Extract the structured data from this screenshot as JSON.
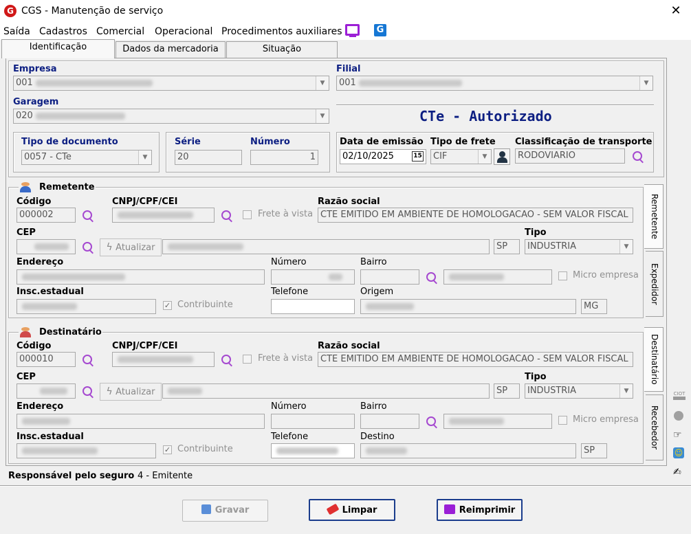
{
  "window": {
    "title": "CGS - Manutenção de serviço",
    "close": "✕",
    "app_icon": "G"
  },
  "menu": [
    "Saída",
    "Cadastros",
    "Comercial",
    "Operacional",
    "Procedimentos auxiliares"
  ],
  "menu_icons": [
    "monitor-icon",
    "cgs-g-icon"
  ],
  "tabs": [
    "Identificação",
    "Dados da mercadoria",
    "Situação"
  ],
  "empresa": {
    "label": "Empresa",
    "value": "001"
  },
  "filial": {
    "label": "Filial",
    "value": "001"
  },
  "garagem": {
    "label": "Garagem",
    "value": "020"
  },
  "status": "CTe - Autorizado",
  "tipo_doc": {
    "label": "Tipo de documento",
    "value": "0057 - CTe"
  },
  "serie": {
    "label": "Série",
    "value": "20"
  },
  "numero": {
    "label": "Número",
    "value": "1"
  },
  "data_emissao": {
    "label": "Data de emissão",
    "value": "02/10/2025",
    "cal": "15"
  },
  "tipo_frete": {
    "label": "Tipo de frete",
    "value": "CIF"
  },
  "classificacao": {
    "label": "Classificação de transporte",
    "value": "RODOVIARIO"
  },
  "remetente": {
    "title": "Remetente",
    "codigo_label": "Código",
    "codigo": "000002",
    "cnpj_label": "CNPJ/CPF/CEI",
    "frete_vista": "Frete à vista",
    "razao_label": "Razão social",
    "razao": "CTE EMITIDO EM AMBIENTE DE HOMOLOGACAO - SEM VALOR FISCAL",
    "cep_label": "CEP",
    "atualizar": "Atualizar",
    "uf": "SP",
    "tipo_label": "Tipo",
    "tipo": "INDUSTRIA",
    "endereco_label": "Endereço",
    "numero_label": "Número",
    "bairro_label": "Bairro",
    "micro": "Micro empresa",
    "insc_label": "Insc.estadual",
    "contribuinte": "Contribuinte",
    "telefone_label": "Telefone",
    "origem_label": "Origem",
    "origem_uf": "MG"
  },
  "destinatario": {
    "title": "Destinatário",
    "codigo_label": "Código",
    "codigo": "000010",
    "cnpj_label": "CNPJ/CPF/CEI",
    "frete_vista": "Frete à vista",
    "razao_label": "Razão social",
    "razao": "CTE EMITIDO EM AMBIENTE DE HOMOLOGACAO - SEM VALOR FISCAL",
    "cep_label": "CEP",
    "atualizar": "Atualizar",
    "uf": "SP",
    "tipo_label": "Tipo",
    "tipo": "INDUSTRIA",
    "endereco_label": "Endereço",
    "numero_label": "Número",
    "bairro_label": "Bairro",
    "micro": "Micro empresa",
    "insc_label": "Insc.estadual",
    "contribuinte": "Contribuinte",
    "telefone_label": "Telefone",
    "destino_label": "Destino",
    "destino_uf": "SP"
  },
  "vtabs": {
    "top": [
      "Remetente",
      "Expedidor"
    ],
    "bottom": [
      "Destinatário",
      "Recebedor"
    ]
  },
  "seguro": {
    "label": "Responsável pelo seguro",
    "value": "4 - Emitente"
  },
  "side_label": "CIOT",
  "buttons": {
    "gravar": "Gravar",
    "limpar": "Limpar",
    "reimprimir": "Reimprimir"
  }
}
